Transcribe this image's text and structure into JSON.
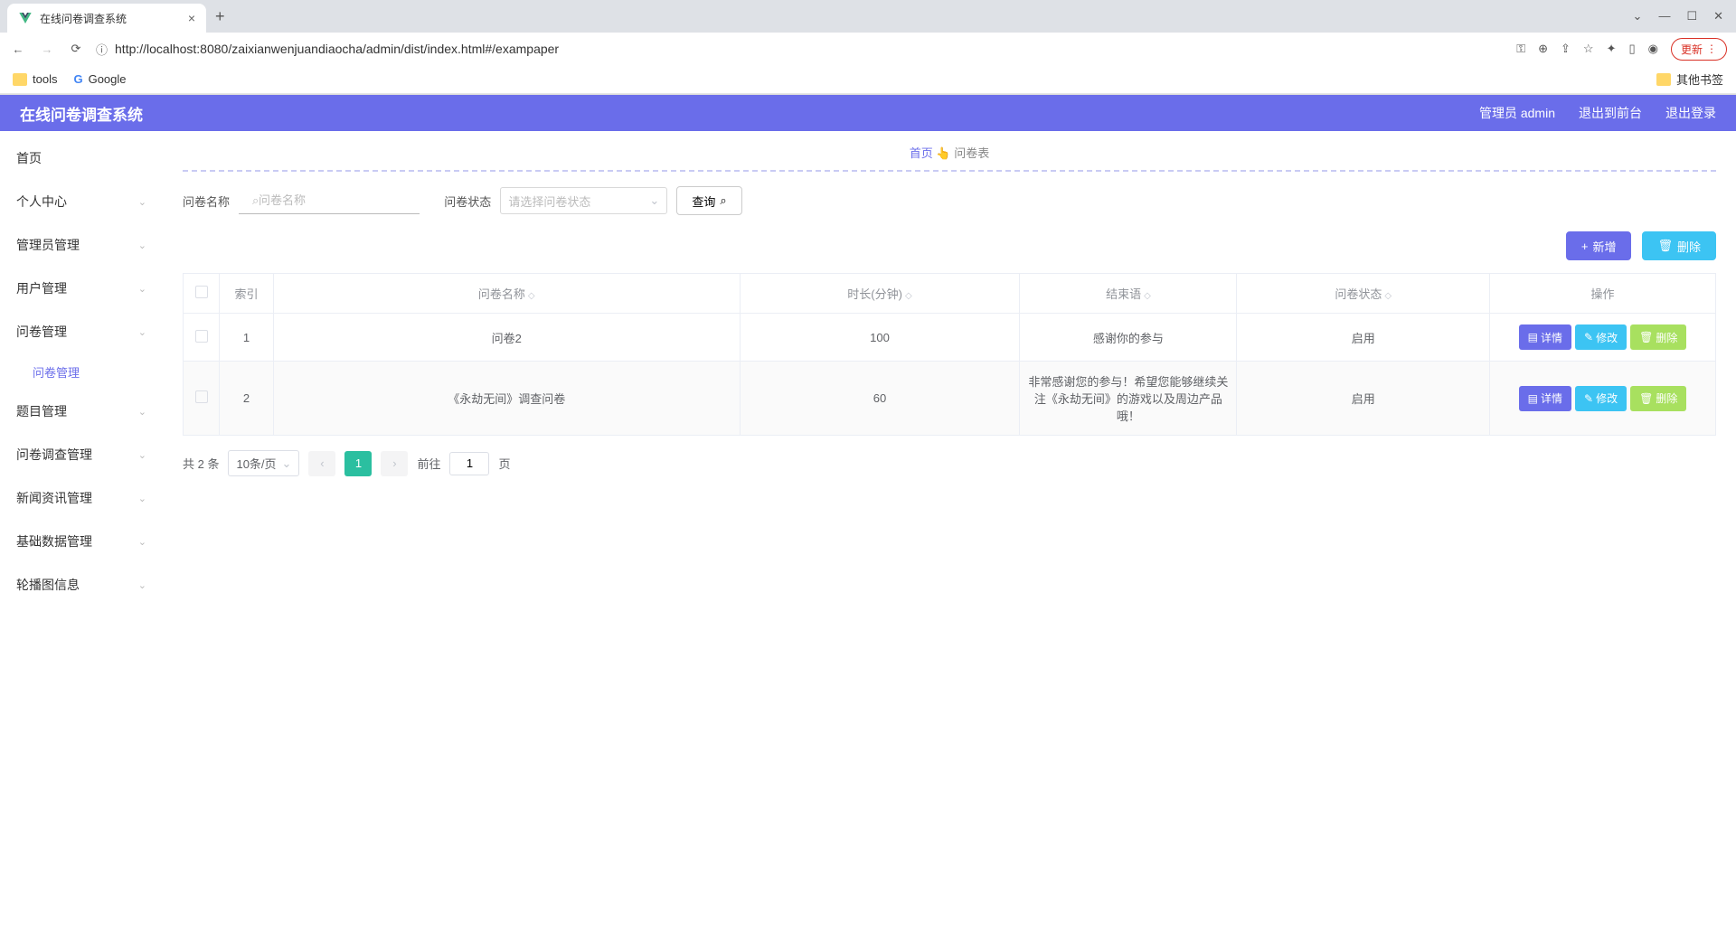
{
  "browser": {
    "tab_title": "在线问卷调查系统",
    "url": "http://localhost:8080/zaixianwenjuandiaocha/admin/dist/index.html#/exampaper",
    "update_label": "更新",
    "bookmarks": {
      "tools": "tools",
      "google": "Google",
      "other": "其他书签"
    }
  },
  "header": {
    "title": "在线问卷调查系统",
    "user": "管理员 admin",
    "to_front": "退出到前台",
    "logout": "退出登录"
  },
  "sidebar": {
    "items": [
      {
        "label": "首页",
        "expandable": false
      },
      {
        "label": "个人中心",
        "expandable": true
      },
      {
        "label": "管理员管理",
        "expandable": true
      },
      {
        "label": "用户管理",
        "expandable": true
      },
      {
        "label": "问卷管理",
        "expandable": true,
        "active_sub": "问卷管理"
      },
      {
        "label": "题目管理",
        "expandable": true
      },
      {
        "label": "问卷调查管理",
        "expandable": true
      },
      {
        "label": "新闻资讯管理",
        "expandable": true
      },
      {
        "label": "基础数据管理",
        "expandable": true
      },
      {
        "label": "轮播图信息",
        "expandable": true
      }
    ]
  },
  "breadcrumb": {
    "home": "首页",
    "current": "问卷表"
  },
  "filters": {
    "name_label": "问卷名称",
    "name_placeholder": "问卷名称",
    "status_label": "问卷状态",
    "status_placeholder": "请选择问卷状态",
    "search_btn": "查询"
  },
  "actions": {
    "add": "新增",
    "delete": "删除"
  },
  "table": {
    "columns": [
      "",
      "索引",
      "问卷名称",
      "时长(分钟)",
      "结束语",
      "问卷状态",
      "操作"
    ],
    "rows": [
      {
        "index": "1",
        "name": "问卷2",
        "duration": "100",
        "end_msg": "感谢你的参与",
        "status": "启用"
      },
      {
        "index": "2",
        "name": "《永劫无间》调查问卷",
        "duration": "60",
        "end_msg": "非常感谢您的参与！希望您能够继续关注《永劫无间》的游戏以及周边产品哦！",
        "status": "启用"
      }
    ],
    "row_actions": {
      "detail": "详情",
      "edit": "修改",
      "delete": "删除"
    }
  },
  "pagination": {
    "total": "共 2 条",
    "page_size": "10条/页",
    "current_page": "1",
    "goto_label": "前往",
    "goto_value": "1",
    "page_suffix": "页"
  }
}
